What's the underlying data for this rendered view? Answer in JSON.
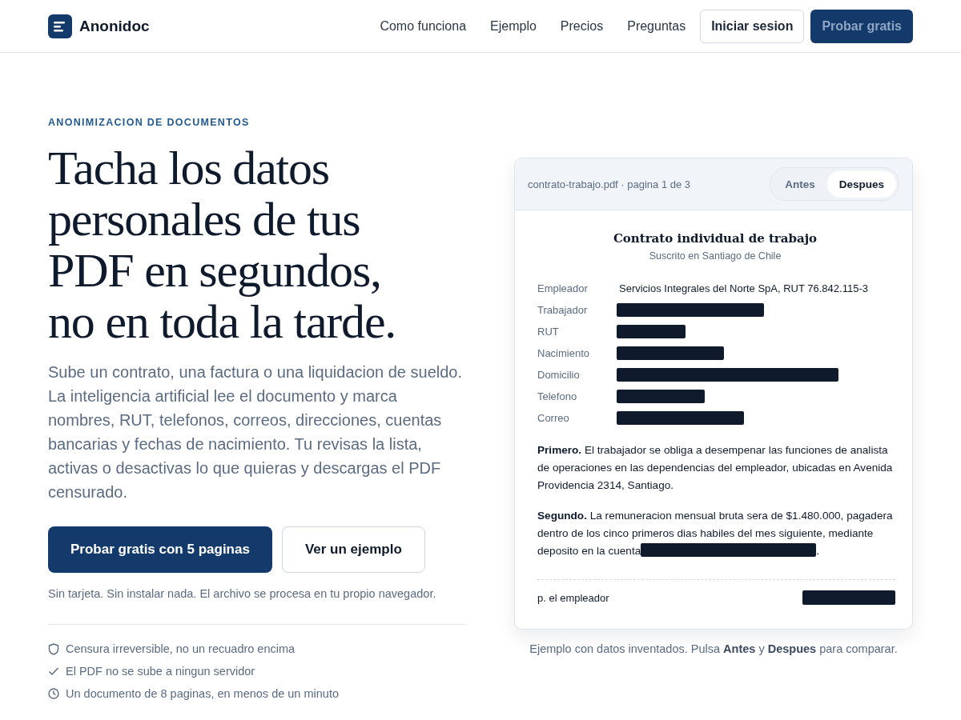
{
  "brand": {
    "name": "Anonidoc"
  },
  "nav": {
    "links": [
      "Como funciona",
      "Ejemplo",
      "Precios",
      "Preguntas"
    ],
    "login": "Iniciar sesion",
    "cta": "Probar gratis"
  },
  "hero": {
    "eyebrow": "ANONIMIZACION DE DOCUMENTOS",
    "title_lines": [
      "Tacha los datos",
      "personales de tus",
      "PDF en segundos,",
      "no en toda la tarde."
    ],
    "description": "Sube un contrato, una factura o una liquidacion de sueldo. La inteligencia artificial lee el documento y marca nombres, RUT, telefonos, correos, direcciones, cuentas bancarias y fechas de nacimiento. Tu revisas la lista, activas o desactivas lo que quieras y descargas el PDF censurado.",
    "primary_button": "Probar gratis con 5 paginas",
    "secondary_button": "Ver un ejemplo",
    "note": "Sin tarjeta. Sin instalar nada. El archivo se procesa en tu propio navegador.",
    "features": [
      {
        "kind": "shield",
        "text": "Censura irreversible, no un recuadro encima"
      },
      {
        "kind": "check",
        "text": "El PDF no se sube a ningun servidor"
      },
      {
        "kind": "clock",
        "text": "Un documento de 8 paginas, en menos de un minuto"
      }
    ]
  },
  "preview": {
    "file": "contrato-trabajo.pdf · pagina 1 de 3",
    "tabs": [
      {
        "label": "Antes",
        "selected": false
      },
      {
        "label": "Despues",
        "selected": true
      }
    ],
    "doc_title": "Contrato individual de trabajo",
    "doc_subtitle": "Suscrito en Santiago de Chile",
    "fields": [
      {
        "label": "Empleador",
        "redacted": false,
        "value": "Servicios Integrales del Norte SpA, RUT 76.842.115-3"
      },
      {
        "label": "Trabajador",
        "redacted": true
      },
      {
        "label": "RUT",
        "redacted": true
      },
      {
        "label": "Nacimiento",
        "redacted": true
      },
      {
        "label": "Domicilio",
        "redacted": true
      },
      {
        "label": "Telefono",
        "redacted": true
      },
      {
        "label": "Correo",
        "redacted": true
      }
    ],
    "clauses": [
      {
        "lead": "Primero.",
        "text": "El trabajador se obliga a desempenar las funciones de analista de operaciones en las dependencias del empleador, ubicadas en Avenida Providencia 2314, Santiago.",
        "redacted_tail": false
      },
      {
        "lead": "Segundo.",
        "text": "La remuneracion mensual bruta sera de $1.480.000, pagadera dentro de los cinco primeros dias habiles del mes siguiente, mediante deposito en la cuenta",
        "redacted_tail": true,
        "end": "."
      }
    ],
    "signature": {
      "label": "p. el empleador",
      "redacted": true
    },
    "caption": "Ejemplo con datos inventados. Pulsa **Antes** y **Despues** para comparar."
  }
}
